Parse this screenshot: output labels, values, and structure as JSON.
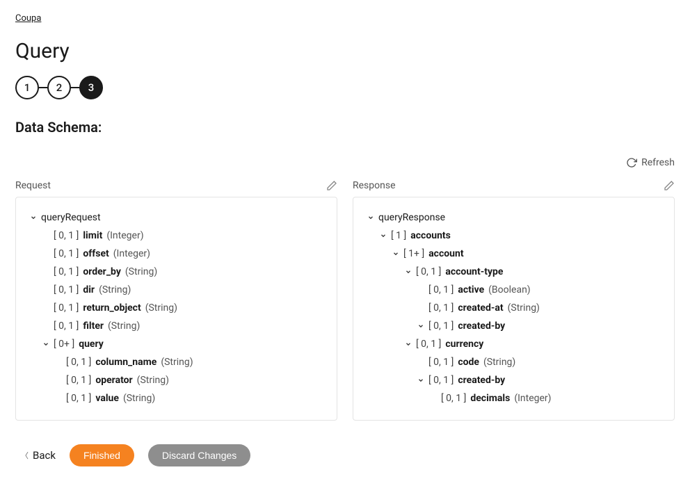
{
  "breadcrumb": "Coupa",
  "page_title": "Query",
  "stepper": {
    "steps": [
      "1",
      "2",
      "3"
    ],
    "active_index": 2
  },
  "section_title": "Data Schema:",
  "refresh_label": "Refresh",
  "request": {
    "label": "Request",
    "root": {
      "name": "queryRequest",
      "children": [
        {
          "card": "[ 0, 1 ]",
          "name": "limit",
          "type": "(Integer)"
        },
        {
          "card": "[ 0, 1 ]",
          "name": "offset",
          "type": "(Integer)"
        },
        {
          "card": "[ 0, 1 ]",
          "name": "order_by",
          "type": "(String)"
        },
        {
          "card": "[ 0, 1 ]",
          "name": "dir",
          "type": "(String)"
        },
        {
          "card": "[ 0, 1 ]",
          "name": "return_object",
          "type": "(String)"
        },
        {
          "card": "[ 0, 1 ]",
          "name": "filter",
          "type": "(String)"
        },
        {
          "card": "[ 0+ ]",
          "name": "query",
          "expandable": true,
          "children": [
            {
              "card": "[ 0, 1 ]",
              "name": "column_name",
              "type": "(String)"
            },
            {
              "card": "[ 0, 1 ]",
              "name": "operator",
              "type": "(String)"
            },
            {
              "card": "[ 0, 1 ]",
              "name": "value",
              "type": "(String)"
            }
          ]
        }
      ]
    }
  },
  "response": {
    "label": "Response",
    "root": {
      "name": "queryResponse",
      "children": [
        {
          "card": "[ 1 ]",
          "name": "accounts",
          "expandable": true,
          "children": [
            {
              "card": "[ 1+ ]",
              "name": "account",
              "expandable": true,
              "children": [
                {
                  "card": "[ 0, 1 ]",
                  "name": "account-type",
                  "expandable": true,
                  "children": [
                    {
                      "card": "[ 0, 1 ]",
                      "name": "active",
                      "type": "(Boolean)"
                    },
                    {
                      "card": "[ 0, 1 ]",
                      "name": "created-at",
                      "type": "(String)"
                    },
                    {
                      "card": "[ 0, 1 ]",
                      "name": "created-by",
                      "expandable": true
                    }
                  ]
                },
                {
                  "card": "[ 0, 1 ]",
                  "name": "currency",
                  "expandable": true,
                  "children": [
                    {
                      "card": "[ 0, 1 ]",
                      "name": "code",
                      "type": "(String)"
                    },
                    {
                      "card": "[ 0, 1 ]",
                      "name": "created-by",
                      "expandable": true,
                      "children": [
                        {
                          "card": "[ 0, 1 ]",
                          "name": "decimals",
                          "type": "(Integer)"
                        }
                      ]
                    }
                  ]
                }
              ]
            }
          ]
        }
      ]
    }
  },
  "footer": {
    "back": "Back",
    "finished": "Finished",
    "discard": "Discard Changes"
  }
}
